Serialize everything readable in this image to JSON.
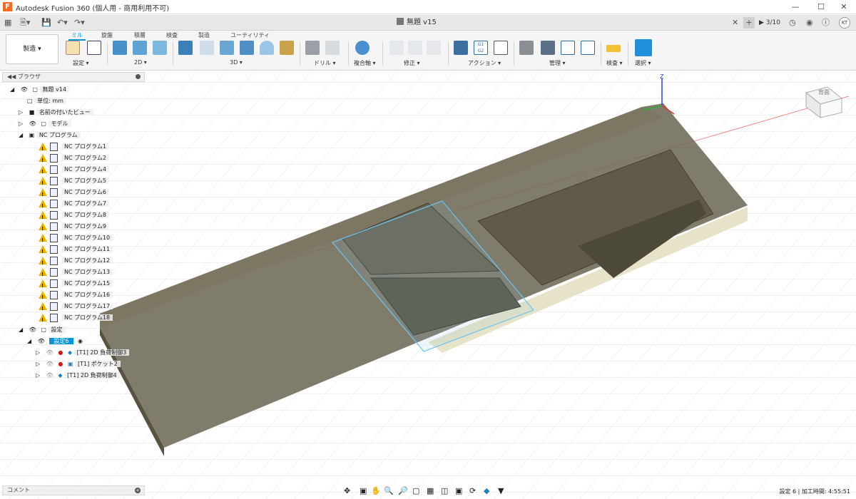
{
  "app": {
    "window_title": "Autodesk Fusion 360 (個人用 - 商用利用不可)",
    "logo_letter": "F",
    "document_tab": "無題 v15",
    "job_count": "3/10",
    "avatar_initials": "KT"
  },
  "toolbar": {
    "workspace": "製造",
    "tabs": [
      "ミル",
      "旋盤",
      "積層",
      "検査",
      "製造",
      "ユーティリティ"
    ],
    "active_tab": 0,
    "groups": [
      "設定",
      "2D",
      "3D",
      "ドリル",
      "複合軸",
      "修正",
      "アクション",
      "管理",
      "検査",
      "選択"
    ]
  },
  "browser": {
    "header": "ブラウザ",
    "root": "無題 v14",
    "units": "単位: mm",
    "named_views": "名前の付いたビュー",
    "model": "モデル",
    "nc_programs_folder": "NC プログラム",
    "nc_programs": [
      "NC プログラム1",
      "NC プログラム2",
      "NC プログラム4",
      "NC プログラム5",
      "NC プログラム6",
      "NC プログラム7",
      "NC プログラム8",
      "NC プログラム9",
      "NC プログラム10",
      "NC プログラム11",
      "NC プログラム12",
      "NC プログラム13",
      "NC プログラム15",
      "NC プログラム16",
      "NC プログラム17",
      "NC プログラム18"
    ],
    "setups": "設定",
    "setup_active": "設定6",
    "operations": [
      "[T1] 2D 負荷制御3",
      "[T1] ポケット2",
      "[T1] 2D 負荷制御4"
    ]
  },
  "viewcube": {
    "label": "背面"
  },
  "axes": {
    "z": "Z"
  },
  "comment": "コメント",
  "status_text": "設定 6 | 加工時間: 4:55:51",
  "colors": {
    "accent": "#0696d7",
    "stock": "#6e6a58",
    "warning": "#e9b400",
    "error": "#d11a1a"
  }
}
